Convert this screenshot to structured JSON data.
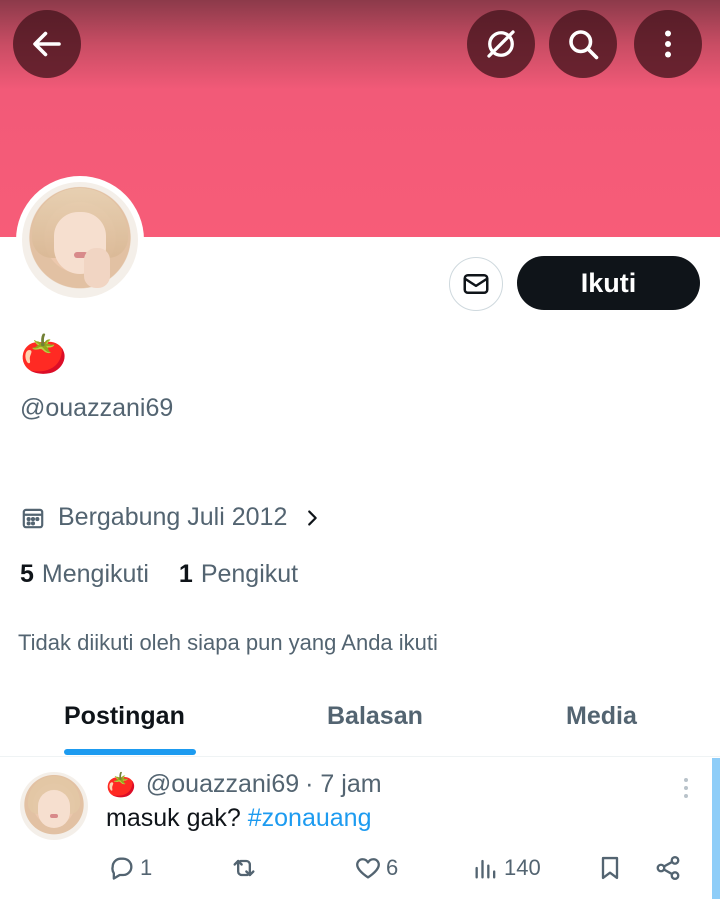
{
  "header": {
    "back_icon": "arrow-left-icon",
    "grok_icon": "grok-icon",
    "search_icon": "search-icon",
    "more_icon": "more-vertical-icon",
    "banner_color": "#f75c78"
  },
  "profile": {
    "display_name": "🍅",
    "handle": "@ouazzani69",
    "joined": "Bergabung Juli 2012",
    "following_count": "5",
    "following_label": "Mengikuti",
    "followers_count": "1",
    "followers_label": "Pengikut",
    "not_followed_text": "Tidak diikuti oleh siapa pun yang Anda ikuti",
    "follow_label": "Ikuti",
    "message_icon": "envelope-icon"
  },
  "tabs": [
    {
      "label": "Postingan",
      "active": true
    },
    {
      "label": "Balasan",
      "active": false
    },
    {
      "label": "Media",
      "active": false
    }
  ],
  "post": {
    "emoji": "🍅",
    "handle": "@ouazzani69",
    "time": "· 7 jam",
    "text": "masuk gak? ",
    "hashtag": "#zonauang",
    "replies": "1",
    "reposts": "",
    "likes": "6",
    "views": "140"
  },
  "colors": {
    "accent": "#1d9bf0",
    "follow_button": "#0f1419"
  }
}
